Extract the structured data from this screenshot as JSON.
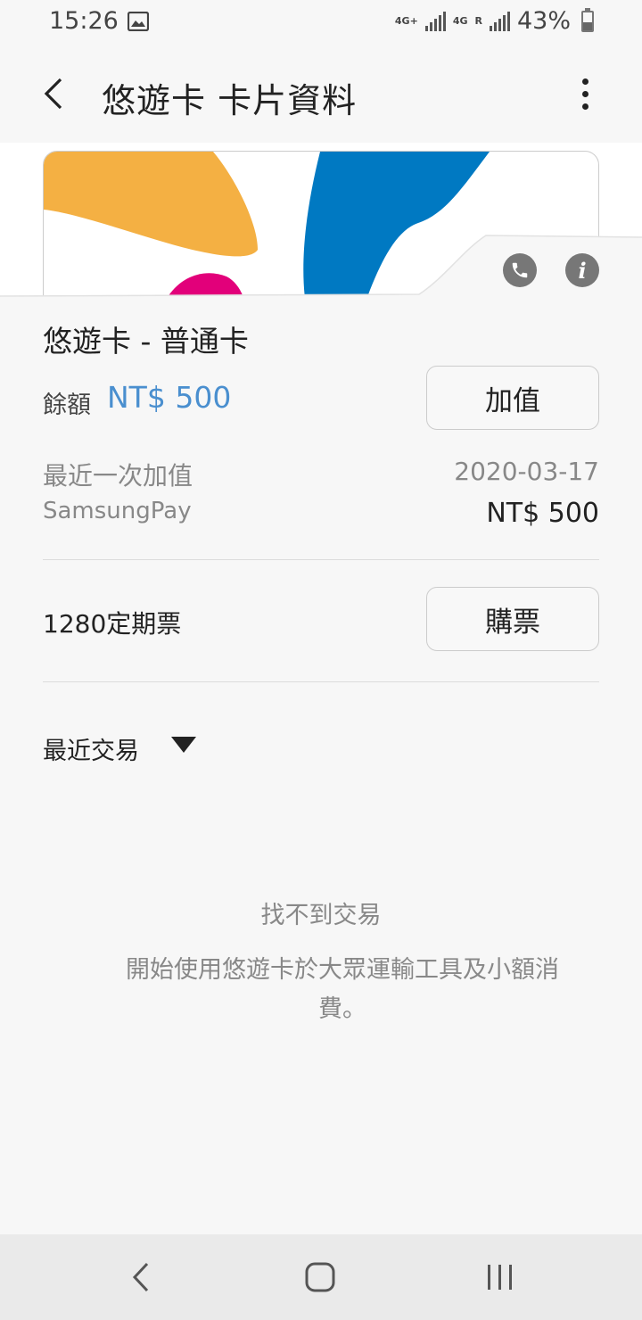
{
  "status_bar": {
    "time": "15:26",
    "network_1": "4G+",
    "network_2": "4G",
    "roaming": "R",
    "battery_percent": "43%",
    "battery_level": 0.43
  },
  "header": {
    "title": "悠遊卡 卡片資料",
    "back_icon": "chevron-left-icon",
    "more_icon": "more-vertical-icon"
  },
  "card": {
    "name": "悠遊卡 - 普通卡",
    "colors": {
      "orange": "#F4B043",
      "blue": "#0079C2",
      "magenta": "#E2007A"
    },
    "actions": [
      "phone-icon",
      "info-icon"
    ]
  },
  "balance": {
    "label": "餘額",
    "value": "NT$ 500",
    "topup_label": "加值"
  },
  "last_topup": {
    "label": "最近一次加值",
    "date": "2020-03-17",
    "source": "SamsungPay",
    "amount": "NT$ 500"
  },
  "pass": {
    "label": "1280定期票",
    "buy_label": "購票"
  },
  "recent": {
    "label": "最近交易",
    "empty_title": "找不到交易",
    "empty_desc": "開始使用悠遊卡於大眾運輸工具及小額消費。"
  },
  "nav": {
    "back_icon": "nav-back-icon",
    "home_icon": "nav-home-icon",
    "recents_icon": "nav-recents-icon"
  },
  "theme": {
    "accent": "#4A8FCF",
    "text_secondary": "#888888"
  }
}
